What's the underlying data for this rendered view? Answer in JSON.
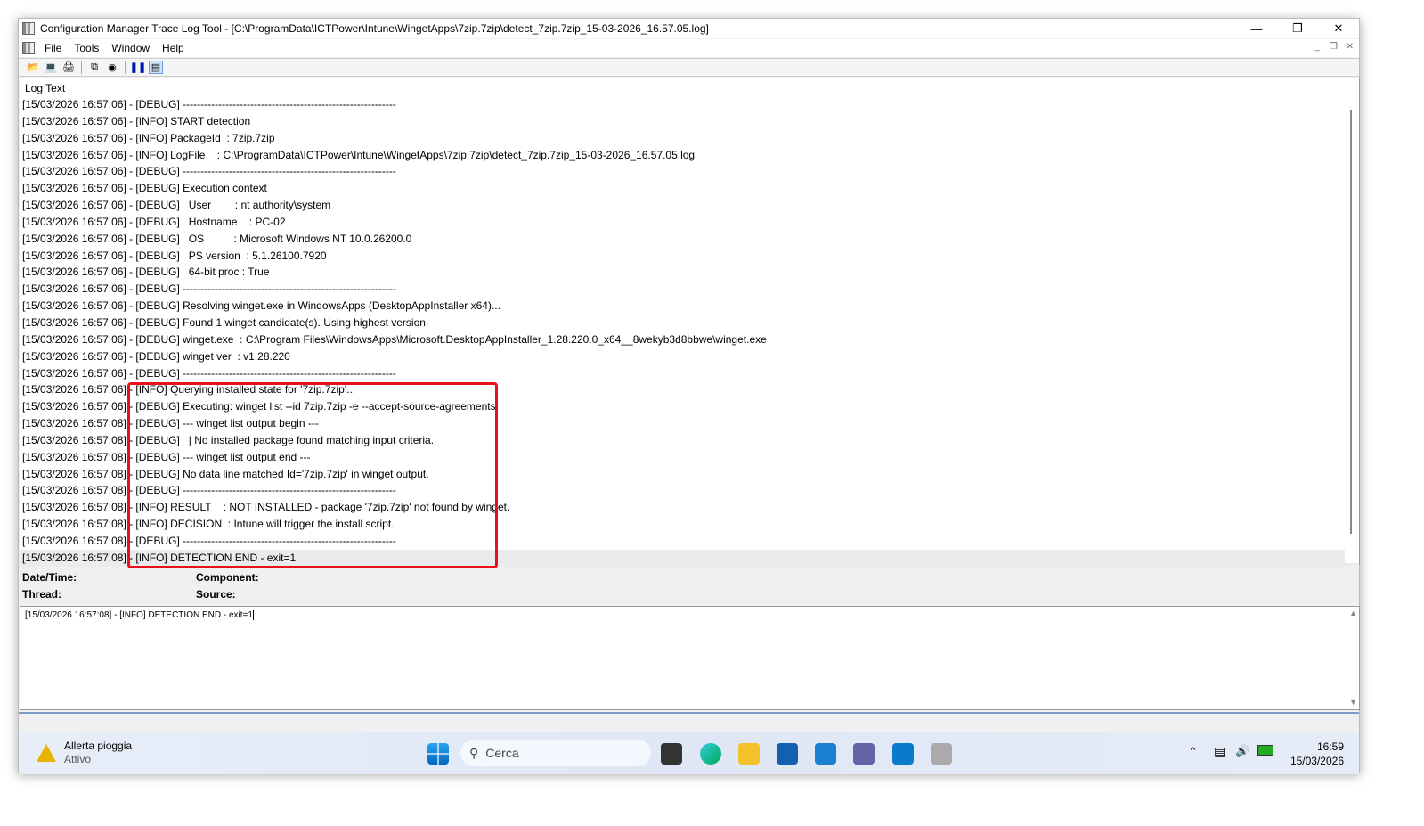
{
  "window": {
    "title": "Configuration Manager Trace Log Tool - [C:\\ProgramData\\ICTPower\\Intune\\WingetApps\\7zip.7zip\\detect_7zip.7zip_15-03-2026_16.57.05.log]"
  },
  "menu": [
    "File",
    "Tools",
    "Window",
    "Help"
  ],
  "toolbar": [
    "open-icon",
    "computer-icon",
    "print-icon",
    "copy-icon",
    "find-icon",
    "pause-icon",
    "preview-pane-icon"
  ],
  "log": {
    "header": "Log Text",
    "rows": [
      "[15/03/2026 16:57:06] - [DEBUG] ------------------------------------------------------------",
      "[15/03/2026 16:57:06] - [INFO] START detection",
      "[15/03/2026 16:57:06] - [INFO] PackageId  : 7zip.7zip",
      "[15/03/2026 16:57:06] - [INFO] LogFile    : C:\\ProgramData\\ICTPower\\Intune\\WingetApps\\7zip.7zip\\detect_7zip.7zip_15-03-2026_16.57.05.log",
      "[15/03/2026 16:57:06] - [DEBUG] ------------------------------------------------------------",
      "[15/03/2026 16:57:06] - [DEBUG] Execution context",
      "[15/03/2026 16:57:06] - [DEBUG]   User        : nt authority\\system",
      "[15/03/2026 16:57:06] - [DEBUG]   Hostname    : PC-02",
      "[15/03/2026 16:57:06] - [DEBUG]   OS          : Microsoft Windows NT 10.0.26200.0",
      "[15/03/2026 16:57:06] - [DEBUG]   PS version  : 5.1.26100.7920",
      "[15/03/2026 16:57:06] - [DEBUG]   64-bit proc : True",
      "[15/03/2026 16:57:06] - [DEBUG] ------------------------------------------------------------",
      "[15/03/2026 16:57:06] - [DEBUG] Resolving winget.exe in WindowsApps (DesktopAppInstaller x64)...",
      "[15/03/2026 16:57:06] - [DEBUG] Found 1 winget candidate(s). Using highest version.",
      "[15/03/2026 16:57:06] - [DEBUG] winget.exe  : C:\\Program Files\\WindowsApps\\Microsoft.DesktopAppInstaller_1.28.220.0_x64__8wekyb3d8bbwe\\winget.exe",
      "[15/03/2026 16:57:06] - [DEBUG] winget ver  : v1.28.220",
      "[15/03/2026 16:57:06] - [DEBUG] ------------------------------------------------------------",
      "[15/03/2026 16:57:06] - [INFO] Querying installed state for '7zip.7zip'...",
      "[15/03/2026 16:57:06] - [DEBUG] Executing: winget list --id 7zip.7zip -e --accept-source-agreements",
      "[15/03/2026 16:57:08] - [DEBUG] --- winget list output begin ---",
      "[15/03/2026 16:57:08] - [DEBUG]   | No installed package found matching input criteria.",
      "[15/03/2026 16:57:08] - [DEBUG] --- winget list output end ---",
      "[15/03/2026 16:57:08] - [DEBUG] No data line matched Id='7zip.7zip' in winget output.",
      "[15/03/2026 16:57:08] - [DEBUG] ------------------------------------------------------------",
      "[15/03/2026 16:57:08] - [INFO] RESULT    : NOT INSTALLED - package '7zip.7zip' not found by winget.",
      "[15/03/2026 16:57:08] - [INFO] DECISION  : Intune will trigger the install script.",
      "[15/03/2026 16:57:08] - [DEBUG] ------------------------------------------------------------",
      "[15/03/2026 16:57:08] - [INFO] DETECTION END - exit=1"
    ]
  },
  "details": {
    "datetime_label": "Date/Time:",
    "component_label": "Component:",
    "thread_label": "Thread:",
    "source_label": "Source:",
    "text": "[15/03/2026 16:57:08] - [INFO] DETECTION END - exit=1"
  },
  "taskbar": {
    "weather_title": "Allerta pioggia",
    "weather_sub": "Attivo",
    "search_placeholder": "Cerca",
    "time": "16:59",
    "date": "15/03/2026"
  },
  "colors": {
    "highlight_box": "#e8101a",
    "accent": "#0067c0"
  }
}
